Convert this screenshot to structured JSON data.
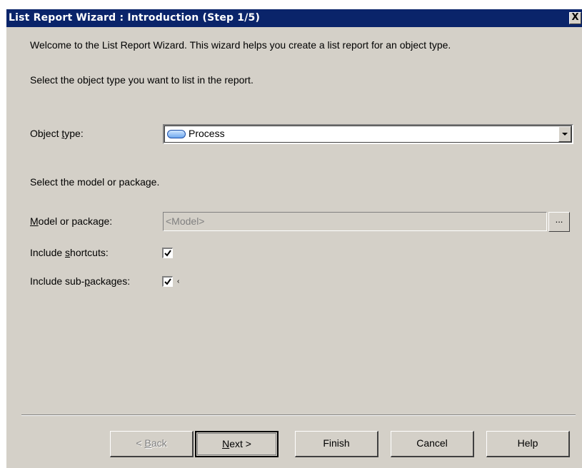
{
  "window": {
    "title": "List Report Wizard : Introduction (Step 1/5)",
    "close_glyph": "X"
  },
  "intro": {
    "welcome": "Welcome to the List Report Wizard. This wizard helps you create a list report for an object type.",
    "select_object_type": "Select the object type you want to list in the report."
  },
  "object_type": {
    "label_prefix": "Object ",
    "label_mnemonic": "t",
    "label_suffix": "ype:",
    "value": "Process",
    "icon": "process-ellipse-icon"
  },
  "model": {
    "section_text": "Select the model or package.",
    "label_mnemonic": "M",
    "label_suffix": "odel or package:",
    "value": "<Model>",
    "browse_label": "..."
  },
  "include_shortcuts": {
    "label_prefix": "Include ",
    "label_mnemonic": "s",
    "label_suffix": "hortcuts:",
    "checked": true
  },
  "include_subpackages": {
    "label_prefix": "Include sub-",
    "label_mnemonic": "p",
    "label_suffix": "ackages:",
    "checked": true,
    "trailing_mark": "‹"
  },
  "buttons": {
    "back_prefix": "< ",
    "back_mnemonic": "B",
    "back_suffix": "ack",
    "next_mnemonic": "N",
    "next_suffix": "ext >",
    "finish": "Finish",
    "cancel": "Cancel",
    "help": "Help"
  },
  "colors": {
    "titlebar": "#0a246a",
    "dialog_face": "#d4d0c8",
    "disabled_text": "#808080"
  }
}
